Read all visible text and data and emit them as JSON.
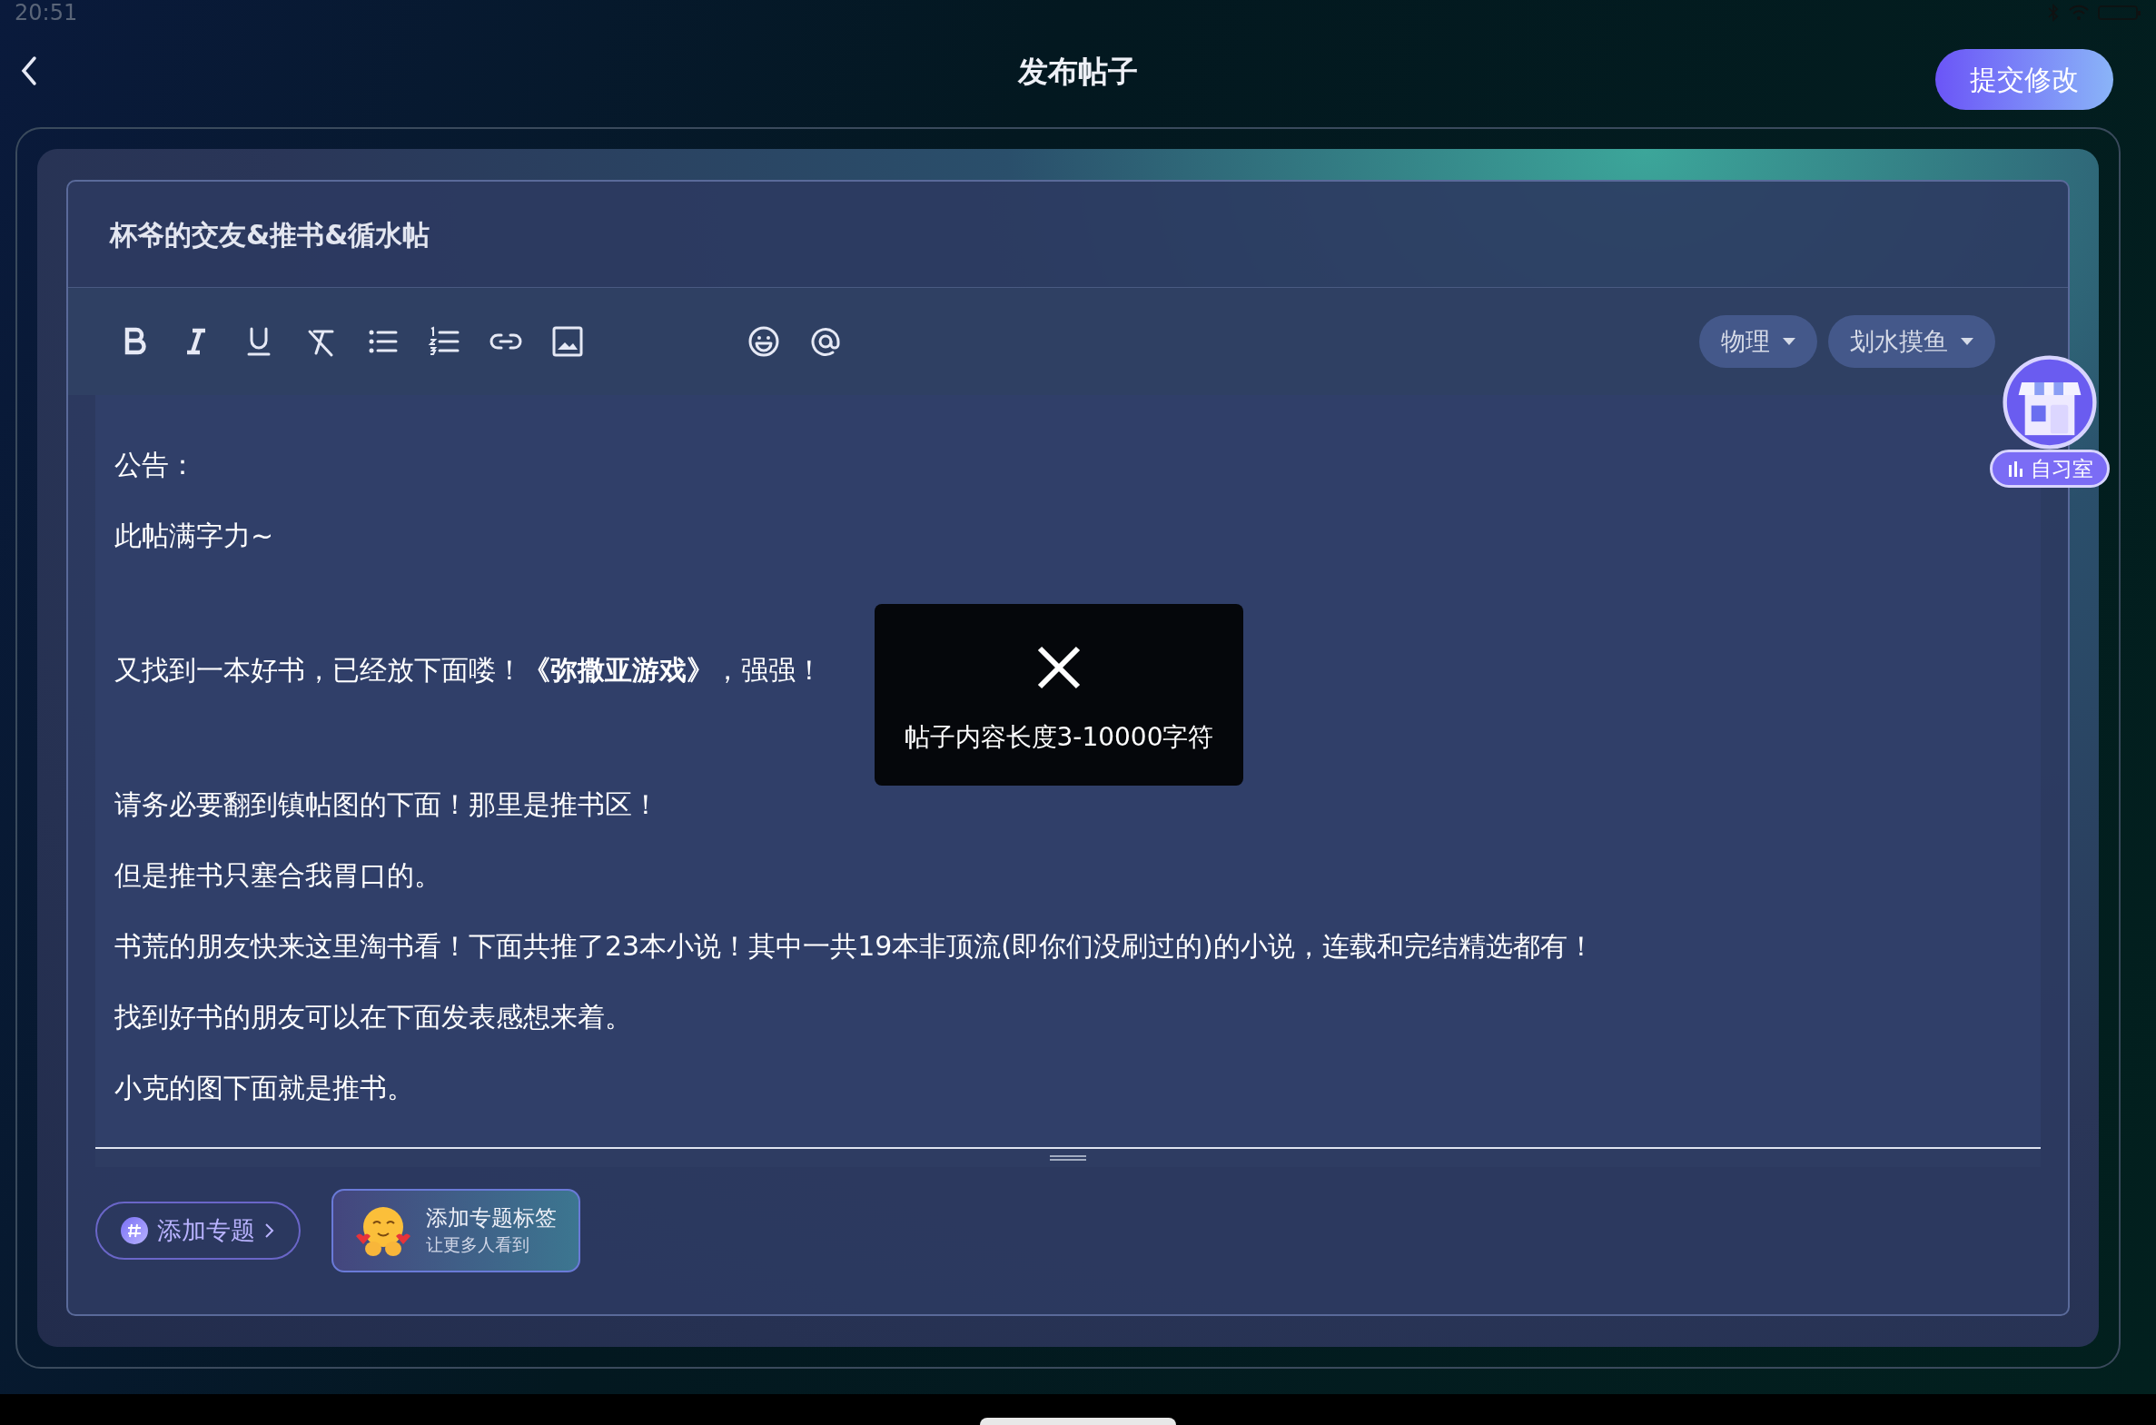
{
  "status_bar": {
    "time": "20:51"
  },
  "header": {
    "title": "发布帖子",
    "submit": "提交修改"
  },
  "post": {
    "title": "杯爷的交友&推书&循水帖"
  },
  "toolbar": {
    "tools": [
      {
        "kind": "bold"
      },
      {
        "kind": "italic"
      },
      {
        "kind": "underline"
      },
      {
        "kind": "clear"
      },
      {
        "kind": "bullets"
      },
      {
        "kind": "numbers"
      },
      {
        "kind": "link"
      },
      {
        "kind": "image"
      },
      {
        "kind": "emoji"
      },
      {
        "kind": "mention"
      }
    ],
    "dropdowns": [
      {
        "label": "物理"
      },
      {
        "label": "划水摸鱼"
      }
    ]
  },
  "study_room": {
    "label": "自习室"
  },
  "content_blocks": [
    [
      "公告：",
      "此帖满字力~"
    ],
    [
      "又找到一本好书，已经放下面喽！**《弥撒亚游戏》**，强强！"
    ],
    [
      "请务必要翻到镇帖图的下面！那里是推书区！",
      "但是推书只塞合我胃口的。",
      "书荒的朋友快来这里淘书看！下面共推了23本小说！其中一共19本非顶流(即你们没刷过的)的小说，连载和完结精选都有！",
      "找到好书的朋友可以在下面发表感想来着。",
      "小克的图下面就是推书。"
    ]
  ],
  "toast": {
    "message": "帖子内容长度3-10000字符"
  },
  "topic": {
    "button": "添加专题",
    "hint_title": "添加专题标签",
    "hint_subtitle": "让更多人看到"
  }
}
